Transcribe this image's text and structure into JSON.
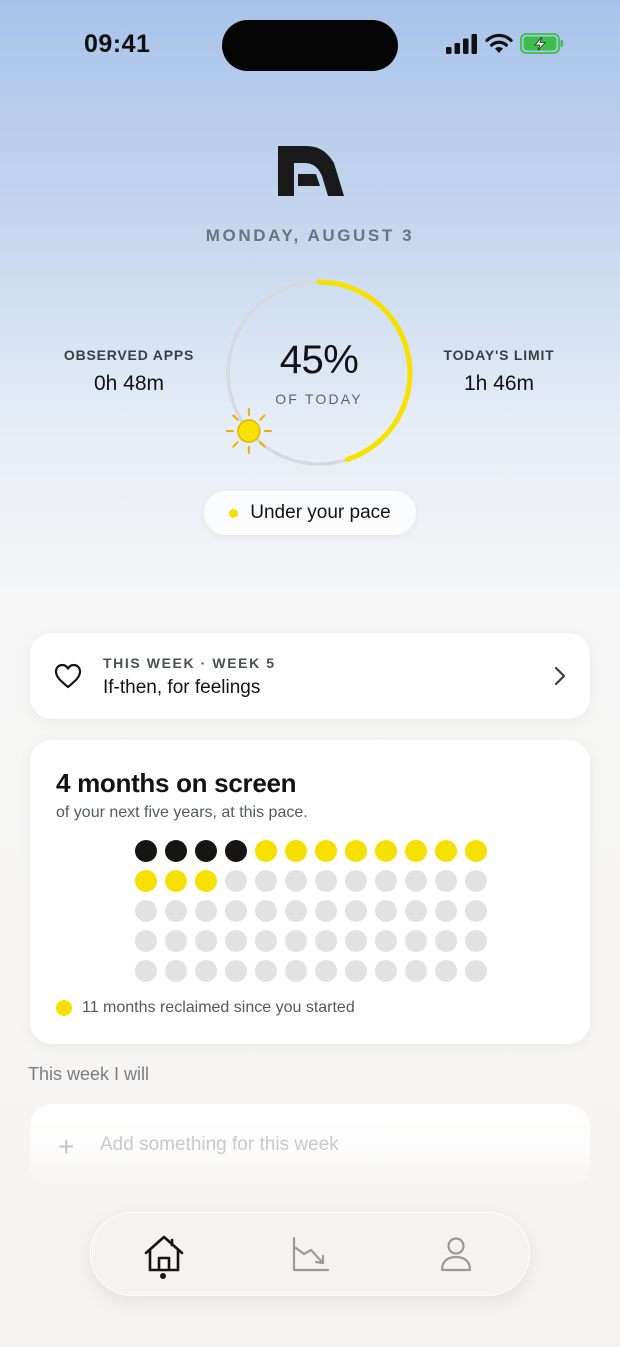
{
  "status_bar": {
    "time": "09:41",
    "icons": [
      "signal-icon",
      "wifi-icon",
      "battery-charging-icon"
    ],
    "battery_color": "#3bbf48"
  },
  "header": {
    "logo": "app-logo",
    "date": "MONDAY, AUGUST 3"
  },
  "summary": {
    "observed_label": "OBSERVED APPS",
    "observed_value": "0h 48m",
    "limit_label": "TODAY'S LIMIT",
    "limit_value": "1h 46m",
    "percent_text": "45%",
    "percent_value": 45,
    "percent_sub": "OF TODAY",
    "sun_icon": "sun-icon",
    "pace_text": "Under your pace"
  },
  "week_card": {
    "label": "THIS WEEK · WEEK 5",
    "title": "If-then, for feelings",
    "icon": "heart-icon"
  },
  "months_card": {
    "title": "4 months on screen",
    "subtitle": "of your next five years, at this pace.",
    "dot_grid": {
      "total": 60,
      "columns": 12,
      "on_screen": 4,
      "reclaimed": 11
    },
    "legend": "11 months reclaimed since you started"
  },
  "week_plan": {
    "label": "This week I will",
    "add_placeholder": "Add something for this week"
  },
  "tab_bar": {
    "tabs": [
      {
        "name": "home",
        "icon": "home-icon",
        "active": true
      },
      {
        "name": "trends",
        "icon": "chart-trend-icon",
        "active": false
      },
      {
        "name": "profile",
        "icon": "person-icon",
        "active": false
      }
    ]
  },
  "colors": {
    "accent_yellow": "#f6e000",
    "dark_dot": "#171414",
    "empty_dot": "#e2e2e2"
  }
}
